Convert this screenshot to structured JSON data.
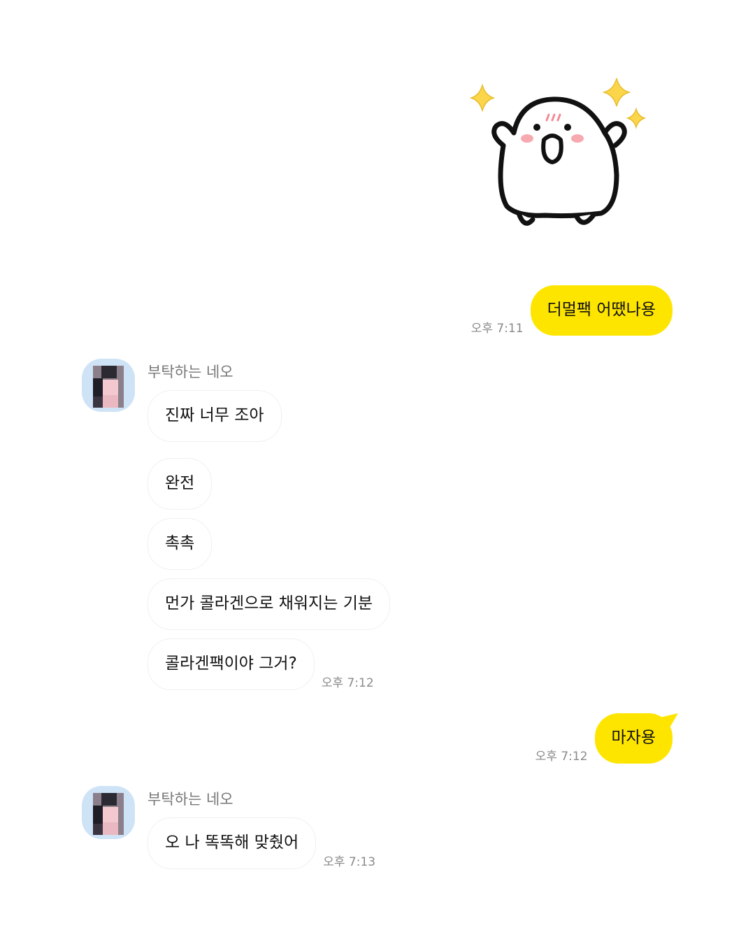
{
  "conversation": {
    "sticker": {
      "icon": "happy-mochi-sticker",
      "sparkle_color": "#fbd54a",
      "blush_color": "#f7a9b0"
    },
    "colors": {
      "my_bubble": "#fee500",
      "other_bubble": "#ffffff",
      "time_text": "#8a8a8a"
    },
    "messages": [
      {
        "from": "me",
        "text": "더멀팩 어땠나용",
        "time": "오후 7:11"
      },
      {
        "from": "other",
        "sender": "부탁하는 네오",
        "texts": [
          "진짜 너무 조아",
          "완전",
          "촉촉",
          "먼가 콜라겐으로 채워지는 기분",
          "콜라겐팩이야 그거?"
        ],
        "time": "오후 7:12"
      },
      {
        "from": "me",
        "text": "마자용",
        "time": "오후 7:12"
      },
      {
        "from": "other",
        "sender": "부탁하는 네오",
        "texts": [
          "오 나 똑똑해 맞췄어"
        ],
        "time": "오후 7:13"
      }
    ]
  }
}
